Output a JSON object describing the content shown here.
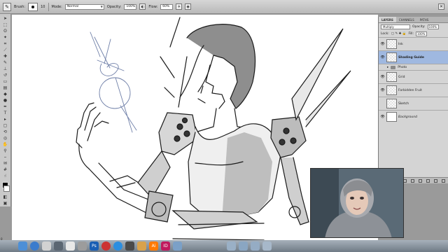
{
  "options_bar": {
    "brush_label": "Brush:",
    "brush_size": "10",
    "mode_label": "Mode:",
    "mode_value": "Normal",
    "opacity_label": "Opacity:",
    "opacity_value": "100%",
    "flow_label": "Flow:",
    "flow_value": "60%"
  },
  "layers_panel": {
    "tabs": [
      "LAYERS",
      "CHANNELS",
      "PATHS"
    ],
    "blend_mode": "Multiply",
    "opacity_label": "Opacity:",
    "opacity_value": "100%",
    "lock_label": "Lock:",
    "fill_label": "Fill:",
    "fill_value": "100%",
    "layers": [
      {
        "name": "Ink",
        "visible": true,
        "selected": false
      },
      {
        "name": "Shading Guide",
        "visible": true,
        "selected": true
      },
      {
        "name": "Grid",
        "visible": true,
        "selected": false
      },
      {
        "name": "Forbidden Fruit",
        "visible": true,
        "selected": false
      },
      {
        "name": "Sketch",
        "visible": false,
        "selected": false
      },
      {
        "name": "Background",
        "visible": true,
        "selected": false
      }
    ],
    "group_name": "Photo"
  },
  "colors": {
    "ui_gray": "#c9c9c9",
    "selected_layer": "#9fb8e0",
    "dock_ai": "#ff7a00",
    "dock_id": "#c0195d",
    "dock_ps": "#1a5fb4"
  },
  "dock": {
    "icons": [
      "finder-icon",
      "safari-icon",
      "mail-icon",
      "photoshop-icon",
      "illustrator-icon",
      "indesign-icon",
      "skype-icon",
      "folder-icon",
      "trash-icon"
    ],
    "ai_label": "Ai",
    "id_label": "ID",
    "ps_label": "Ps"
  },
  "status": "0"
}
